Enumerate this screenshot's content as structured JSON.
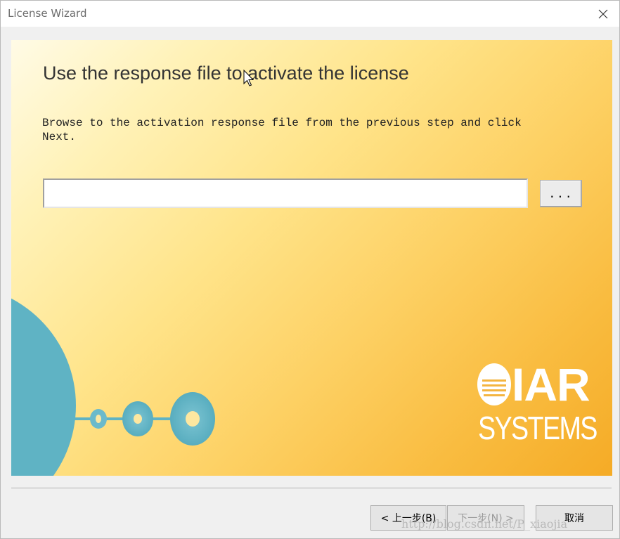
{
  "window": {
    "title": "License Wizard",
    "close_icon": "close-icon"
  },
  "main": {
    "heading": "Use the response file to activate the license",
    "description": "Browse to the activation response file from the previous step and click\nNext.",
    "file_path_value": "",
    "browse_label": "...",
    "logo": {
      "line1": "IAR",
      "line2": "SYSTEMS"
    }
  },
  "footer": {
    "back_label": "< 上一步(B)",
    "next_label": "下一步(N) >",
    "cancel_label": "取消"
  },
  "watermark": "http://blog.csdn.net/P_xiaojia",
  "colors": {
    "panel_gradient_start": "#fffbe6",
    "panel_gradient_end": "#f5ab26",
    "graphic_blue": "#5fb3c4",
    "title_text": "#6d6d6d",
    "disabled_text": "#9a9a9a"
  }
}
